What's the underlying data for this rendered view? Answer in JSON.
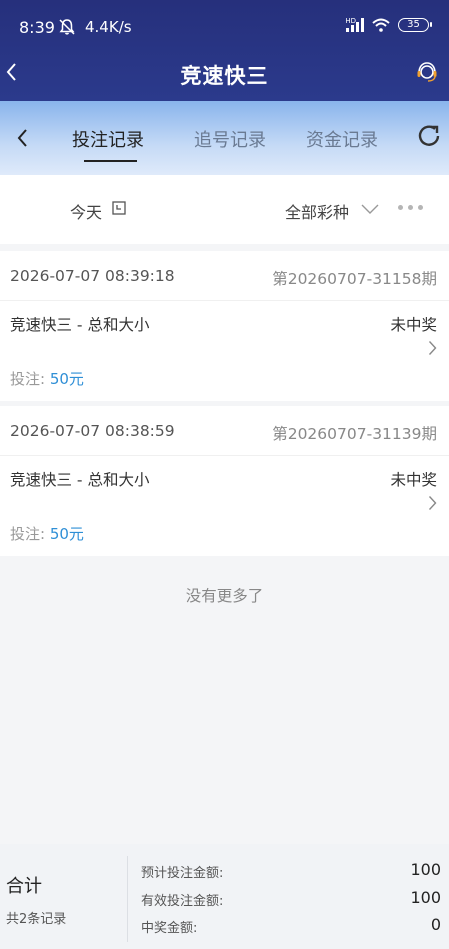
{
  "status_bar": {
    "time": "8:39",
    "net_speed": "4.4K/s",
    "hd_label": "HD",
    "battery": "35"
  },
  "header": {
    "title": "竞速快三"
  },
  "tabs": [
    {
      "label": "投注记录",
      "active": true
    },
    {
      "label": "追号记录",
      "active": false
    },
    {
      "label": "资金记录",
      "active": false
    }
  ],
  "filter": {
    "date_label": "今天",
    "lottery_label": "全部彩种"
  },
  "records": [
    {
      "time": "2026-07-07 08:39:18",
      "period": "第20260707-31158期",
      "game": "竞速快三 - 总和大小",
      "result": "未中奖",
      "bet_label": "投注:",
      "bet_amount": "50元"
    },
    {
      "time": "2026-07-07 08:38:59",
      "period": "第20260707-31139期",
      "game": "竞速快三 - 总和大小",
      "result": "未中奖",
      "bet_label": "投注:",
      "bet_amount": "50元"
    }
  ],
  "no_more_text": "没有更多了",
  "summary": {
    "title": "合计",
    "record_count": "共2条记录",
    "rows": [
      {
        "label": "预计投注金额:",
        "value": "100"
      },
      {
        "label": "有效投注金额:",
        "value": "100"
      },
      {
        "label": "中奖金额:",
        "value": "0"
      }
    ]
  },
  "colors": {
    "header_bg": "#26307c",
    "tab_bg": "#89b4ec",
    "bet_amount": "#2f8fd6"
  }
}
